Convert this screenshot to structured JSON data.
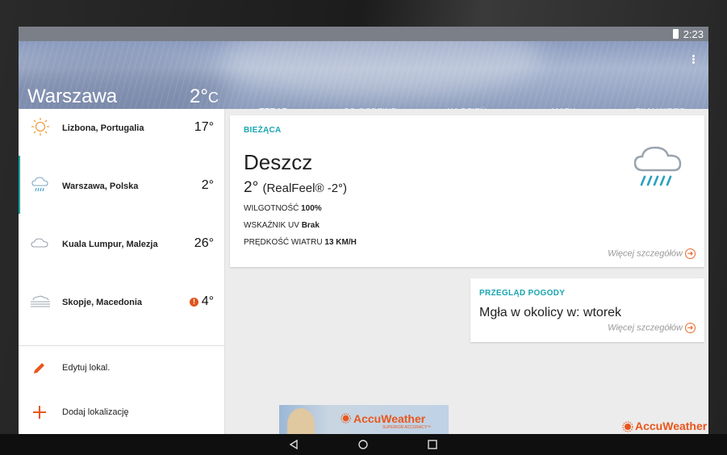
{
  "status_bar": {
    "time": "2:23"
  },
  "header": {
    "city": "Warszawa",
    "temp": "2°",
    "temp_unit": "C",
    "tabs": [
      {
        "label": "TERAZ",
        "active": true
      },
      {
        "label": "CO GODZINĘ",
        "active": false
      },
      {
        "label": "NA DZIEŃ",
        "active": false
      },
      {
        "label": "MAPY",
        "active": false
      },
      {
        "label": "FILM WIDEO",
        "active": false
      }
    ]
  },
  "sidebar": {
    "locations": [
      {
        "name": "Lizbona, Portugalia",
        "temp": "17°",
        "icon": "sun-icon"
      },
      {
        "name": "Warszawa, Polska",
        "temp": "2°",
        "icon": "rain-cloud-icon",
        "selected": true
      },
      {
        "name": "Kuala Lumpur, Malezja",
        "temp": "26°",
        "icon": "cloud-icon"
      },
      {
        "name": "Skopje, Macedonia",
        "temp": "4°",
        "icon": "fog-icon",
        "alert": "!"
      }
    ],
    "actions": [
      {
        "label": "Edytuj lokal.",
        "icon": "pencil-icon"
      },
      {
        "label": "Dodaj lokalizację",
        "icon": "plus-icon"
      }
    ]
  },
  "current": {
    "title": "BIEŻĄCA",
    "condition": "Deszcz",
    "temp": "2°",
    "realfeel": "(RealFeel® -2°)",
    "humidity_label": "WILGOTNOŚĆ",
    "humidity_value": "100%",
    "uv_label": "WSKAŹNIK UV",
    "uv_value": "Brak",
    "wind_label": "PRĘDKOŚĆ WIATRU",
    "wind_value": "13 KM/H",
    "more": "Więcej szczegółów",
    "icon": "rain-cloud-icon"
  },
  "overview": {
    "title": "PRZEGLĄD POGODY",
    "text": "Mgła w okolicy w: wtorek",
    "more": "Więcej szczegółów"
  },
  "ad": {
    "brand": "AccuWeather",
    "tagline": "SUPERIOR ACCURACY™"
  },
  "footer_brand": "AccuWeather",
  "colors": {
    "accent": "#19a6b0",
    "orange": "#e8692a",
    "tab_indicator": "#f0a040"
  }
}
